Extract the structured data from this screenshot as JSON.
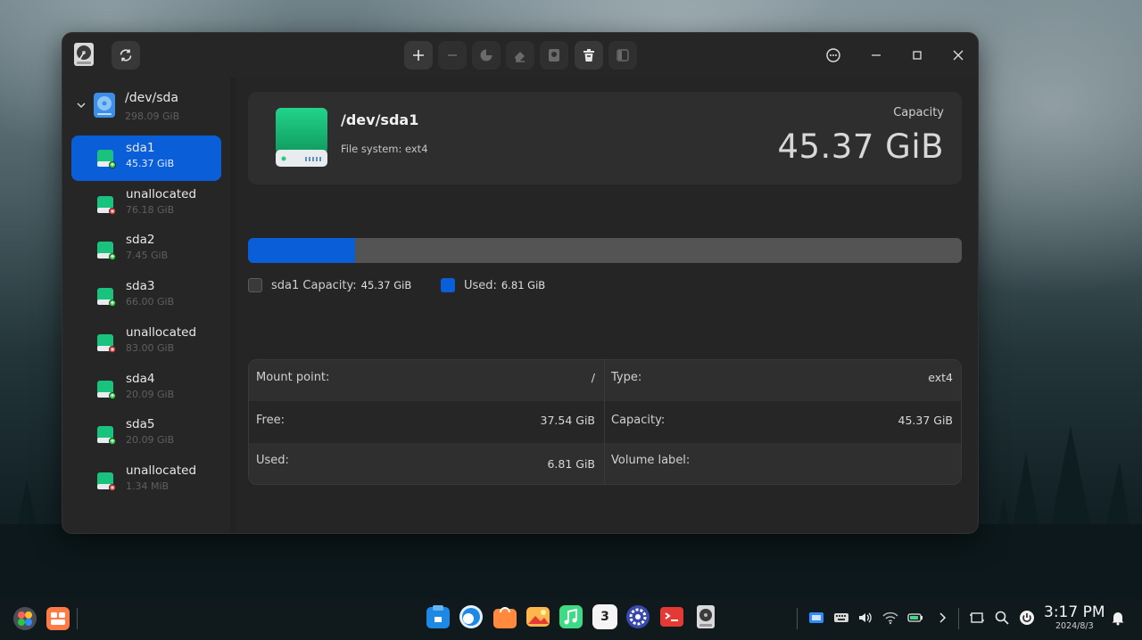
{
  "window": {
    "title_icon": "harddisk-icon",
    "toolbar": [
      {
        "name": "refresh",
        "icon": "refresh-icon"
      },
      {
        "name": "create-partition",
        "icon": "plus-icon"
      },
      {
        "name": "delete-partition",
        "icon": "minus-icon"
      },
      {
        "name": "resize",
        "icon": "pie-icon"
      },
      {
        "name": "wipe",
        "icon": "eraser-icon"
      },
      {
        "name": "mount",
        "icon": "mount-icon"
      },
      {
        "name": "unmount",
        "icon": "trash-icon"
      },
      {
        "name": "panel",
        "icon": "sidebar-icon"
      }
    ]
  },
  "sidebar": {
    "disk": {
      "name": "/dev/sda",
      "size": "298.09 GiB"
    },
    "partitions": [
      {
        "name": "sda1",
        "size": "45.37 GiB",
        "status": "ok",
        "active": true
      },
      {
        "name": "unallocated",
        "size": "76.18 GiB",
        "status": "unallocated",
        "active": false
      },
      {
        "name": "sda2",
        "size": "7.45 GiB",
        "status": "ok",
        "active": false
      },
      {
        "name": "sda3",
        "size": "66.00 GiB",
        "status": "ok",
        "active": false
      },
      {
        "name": "unallocated",
        "size": "83.00 GiB",
        "status": "unallocated",
        "active": false
      },
      {
        "name": "sda4",
        "size": "20.09 GiB",
        "status": "ok",
        "active": false
      },
      {
        "name": "sda5",
        "size": "20.09 GiB",
        "status": "ok",
        "active": false
      },
      {
        "name": "unallocated",
        "size": "1.34 MiB",
        "status": "unallocated",
        "active": false
      }
    ]
  },
  "details": {
    "name": "/dev/sda1",
    "filesystem": "File system: ext4",
    "capacity_label": "Capacity",
    "capacity_value": "45.37 GiB",
    "used_fraction": 0.15,
    "legend": {
      "capacity_label": "sda1 Capacity:",
      "capacity_value": "45.37 GiB",
      "used_label": "Used:",
      "used_value": "6.81 GiB"
    },
    "table": {
      "mount_label": "Mount point:",
      "mount_value": "/",
      "type_label": "Type:",
      "type_value": "ext4",
      "free_label": "Free:",
      "free_value": "37.54 GiB",
      "capacity_label": "Capacity:",
      "capacity_value": "45.37 GiB",
      "used_label": "Used:",
      "used_value": "6.81 GiB",
      "volume_label": "Volume label:",
      "volume_value": ""
    }
  },
  "colors": {
    "accent": "#0a5fd9",
    "drive_green": "#19c37d",
    "status_ok": "#2ecc40",
    "status_unallocated": "#e0413a"
  },
  "taskbar": {
    "apps": [
      "launcher-icon",
      "multitask-icon",
      "app-store-icon",
      "browser-icon",
      "deepin-store-icon",
      "image-viewer-icon",
      "music-icon",
      "calendar-icon",
      "settings-icon",
      "terminal-icon",
      "disk-utility-icon"
    ],
    "calendar_day": "3",
    "time": "3:17 PM",
    "date": "2024/8/3"
  }
}
